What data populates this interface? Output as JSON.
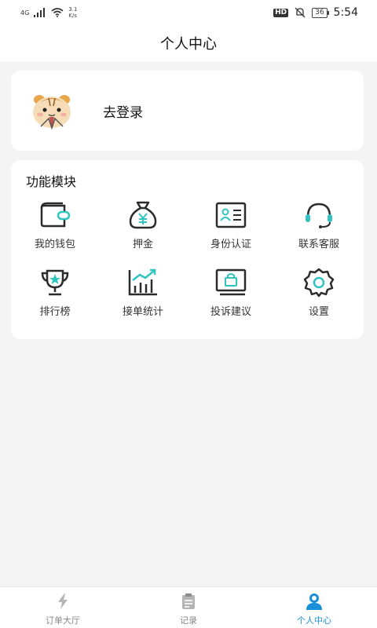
{
  "status_bar": {
    "net_type": "4G",
    "speed_value": "3.1",
    "speed_unit": "K/s",
    "hd": "HD",
    "battery": "36",
    "time": "5:54"
  },
  "header": {
    "title": "个人中心"
  },
  "login": {
    "avatar_icon": "hamster-avatar",
    "label": "去登录"
  },
  "functions": {
    "title": "功能模块",
    "items": [
      {
        "label": "我的钱包",
        "icon": "wallet-icon"
      },
      {
        "label": "押金",
        "icon": "money-bag-icon"
      },
      {
        "label": "身份认证",
        "icon": "id-card-icon"
      },
      {
        "label": "联系客服",
        "icon": "headset-icon"
      },
      {
        "label": "排行榜",
        "icon": "trophy-icon"
      },
      {
        "label": "接单统计",
        "icon": "bar-chart-icon"
      },
      {
        "label": "投诉建议",
        "icon": "complaint-icon"
      },
      {
        "label": "设置",
        "icon": "gear-icon"
      }
    ]
  },
  "tabbar": {
    "tabs": [
      {
        "label": "订单大厅",
        "icon": "lightning-icon",
        "active": false
      },
      {
        "label": "记录",
        "icon": "clipboard-icon",
        "active": false
      },
      {
        "label": "个人中心",
        "icon": "user-icon",
        "active": true
      }
    ]
  },
  "colors": {
    "accent": "#2fc4c0",
    "active_tab": "#1a8fd9",
    "icon_dark": "#2b2b2b"
  }
}
